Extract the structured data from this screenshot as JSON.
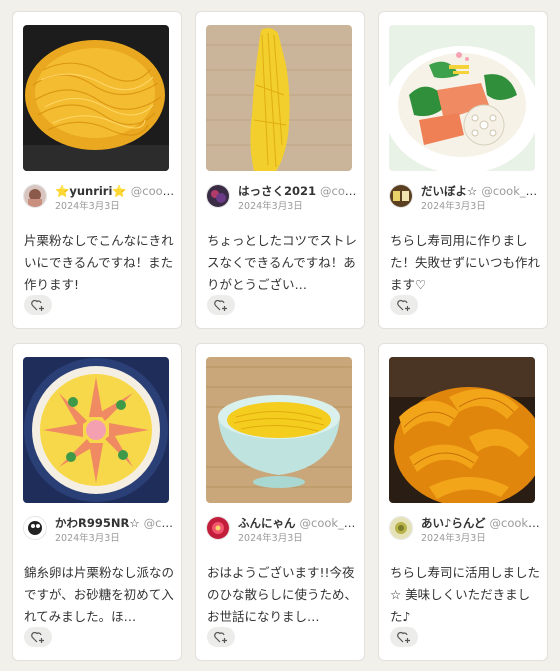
{
  "cards": [
    {
      "user": "⭐yunriri⭐",
      "handle": "@cook_...",
      "date": "2024年3月3日",
      "comment": "片栗粉なしでこんなにきれいにできるんですね！また作ります!"
    },
    {
      "user": "はっさく2021",
      "handle": "@coo...",
      "date": "2024年3月3日",
      "comment": "ちょっとしたコツでストレスなくできるんですね！ありがとうござい…"
    },
    {
      "user": "だいぼよ☆",
      "handle": "@cook_4...",
      "date": "2024年3月3日",
      "comment": "ちらし寿司用に作りました！失敗せずにいつも作れます♡"
    },
    {
      "user": "かわR995NR☆",
      "handle": "@co...",
      "date": "2024年3月3日",
      "comment": "錦糸卵は片栗粉なし派なのですが、お砂糖を初めて入れてみました。ほ…"
    },
    {
      "user": "ふんにゃん",
      "handle": "@cook_4...",
      "date": "2024年3月3日",
      "comment": "おはようございます!!今夜のひな散らしに使うため、お世話になりまし…"
    },
    {
      "user": "あい♪らんど",
      "handle": "@cook_...",
      "date": "2024年3月3日",
      "comment": "ちらし寿司に活用しました☆ 美味しくいただきました♪"
    }
  ],
  "icons": {
    "like": "heart-plus-icon"
  },
  "colors": {
    "egg": "#f2c21a",
    "card": "#ffffff",
    "page": "#f1f0eb"
  }
}
